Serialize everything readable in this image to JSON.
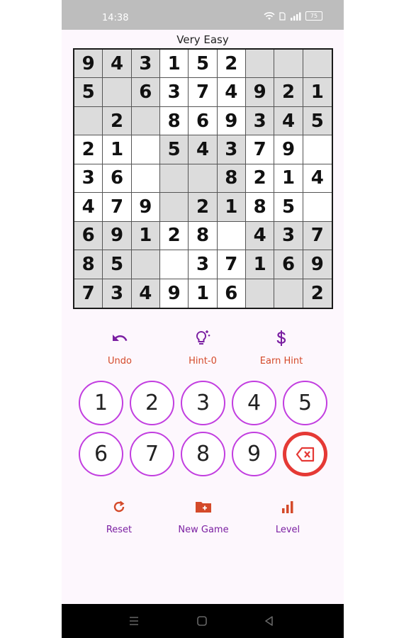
{
  "status": {
    "time": "14:38",
    "battery": "75"
  },
  "title": "Very Easy",
  "grid": [
    [
      "9",
      "4",
      "3",
      "1",
      "5",
      "2",
      "",
      "",
      ""
    ],
    [
      "5",
      "",
      "6",
      "3",
      "7",
      "4",
      "9",
      "2",
      "1"
    ],
    [
      "",
      "2",
      "",
      "8",
      "6",
      "9",
      "3",
      "4",
      "5"
    ],
    [
      "2",
      "1",
      "",
      "5",
      "4",
      "3",
      "7",
      "9",
      ""
    ],
    [
      "3",
      "6",
      "",
      "",
      "",
      "8",
      "2",
      "1",
      "4"
    ],
    [
      "4",
      "7",
      "9",
      "",
      "2",
      "1",
      "8",
      "5",
      ""
    ],
    [
      "6",
      "9",
      "1",
      "2",
      "8",
      "",
      "4",
      "3",
      "7"
    ],
    [
      "8",
      "5",
      "",
      "",
      "3",
      "7",
      "1",
      "6",
      "9"
    ],
    [
      "7",
      "3",
      "4",
      "9",
      "1",
      "6",
      "",
      "",
      "2"
    ]
  ],
  "shaded": [
    [
      1,
      1,
      1,
      0,
      0,
      0,
      1,
      1,
      1
    ],
    [
      1,
      1,
      1,
      0,
      0,
      0,
      1,
      1,
      1
    ],
    [
      1,
      1,
      1,
      0,
      0,
      0,
      1,
      1,
      1
    ],
    [
      0,
      0,
      0,
      1,
      1,
      1,
      0,
      0,
      0
    ],
    [
      0,
      0,
      0,
      1,
      1,
      1,
      0,
      0,
      0
    ],
    [
      0,
      0,
      0,
      1,
      1,
      1,
      0,
      0,
      0
    ],
    [
      1,
      1,
      1,
      0,
      0,
      0,
      1,
      1,
      1
    ],
    [
      1,
      1,
      1,
      0,
      0,
      0,
      1,
      1,
      1
    ],
    [
      1,
      1,
      1,
      0,
      0,
      0,
      1,
      1,
      1
    ]
  ],
  "actions": {
    "undo": "Undo",
    "hint": "Hint-0",
    "earn_hint": "Earn Hint"
  },
  "keypad": [
    "1",
    "2",
    "3",
    "4",
    "5",
    "6",
    "7",
    "8",
    "9"
  ],
  "bottom": {
    "reset": "Reset",
    "new_game": "New Game",
    "level": "Level"
  },
  "colors": {
    "accent_purple": "#c23ee0",
    "icon_purple": "#7b1fa2",
    "label_orange": "#d44a2a",
    "erase_red": "#e53935"
  }
}
